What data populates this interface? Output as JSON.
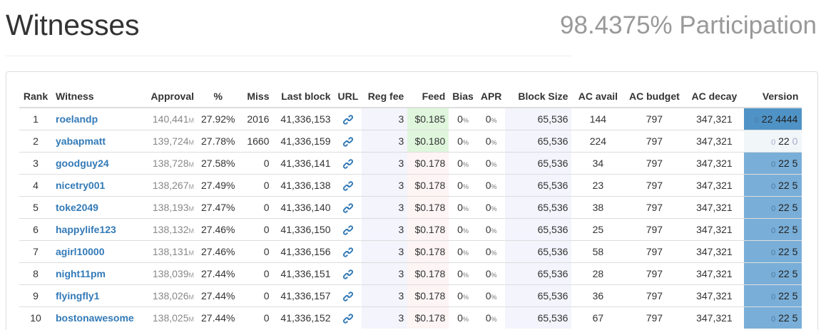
{
  "header": {
    "title": "Witnesses",
    "participation": "98.4375% Participation"
  },
  "table": {
    "columns": {
      "rank": "Rank",
      "witness": "Witness",
      "approval": "Approval",
      "percent": "%",
      "miss": "Miss",
      "last_block": "Last block",
      "url": "URL",
      "reg_fee": "Reg fee",
      "feed": "Feed",
      "bias": "Bias",
      "apr": "APR",
      "block_size": "Block Size",
      "ac_avail": "AC avail",
      "ac_budget": "AC budget",
      "ac_decay": "AC decay",
      "version": "Version"
    },
    "approval_unit": "M",
    "percent_unit": "%",
    "url_icon": "link-icon",
    "rows": [
      {
        "rank": "1",
        "name": "roelandp",
        "approval": "140,441",
        "percent": "27.92%",
        "miss": "2016",
        "last_block": "41,336,153",
        "reg_fee": "3",
        "feed": "$0.185",
        "bias": "0",
        "apr": "0",
        "block_size": "65,536",
        "ac_avail": "144",
        "ac_budget": "797",
        "ac_decay": "347,321",
        "ver_major": "0",
        "ver_minor": "22",
        "ver_patch": "4444"
      },
      {
        "rank": "2",
        "name": "yabapmatt",
        "approval": "139,724",
        "percent": "27.78%",
        "miss": "1660",
        "last_block": "41,336,159",
        "reg_fee": "3",
        "feed": "$0.180",
        "bias": "0",
        "apr": "0",
        "block_size": "65,536",
        "ac_avail": "224",
        "ac_budget": "797",
        "ac_decay": "347,321",
        "ver_major": "0",
        "ver_minor": "22",
        "ver_patch": "0"
      },
      {
        "rank": "3",
        "name": "goodguy24",
        "approval": "138,728",
        "percent": "27.58%",
        "miss": "0",
        "last_block": "41,336,141",
        "reg_fee": "3",
        "feed": "$0.178",
        "bias": "0",
        "apr": "0",
        "block_size": "65,536",
        "ac_avail": "34",
        "ac_budget": "797",
        "ac_decay": "347,321",
        "ver_major": "0",
        "ver_minor": "22",
        "ver_patch": "5"
      },
      {
        "rank": "4",
        "name": "nicetry001",
        "approval": "138,267",
        "percent": "27.49%",
        "miss": "0",
        "last_block": "41,336,138",
        "reg_fee": "3",
        "feed": "$0.178",
        "bias": "0",
        "apr": "0",
        "block_size": "65,536",
        "ac_avail": "23",
        "ac_budget": "797",
        "ac_decay": "347,321",
        "ver_major": "0",
        "ver_minor": "22",
        "ver_patch": "5"
      },
      {
        "rank": "5",
        "name": "toke2049",
        "approval": "138,193",
        "percent": "27.47%",
        "miss": "0",
        "last_block": "41,336,140",
        "reg_fee": "3",
        "feed": "$0.178",
        "bias": "0",
        "apr": "0",
        "block_size": "65,536",
        "ac_avail": "38",
        "ac_budget": "797",
        "ac_decay": "347,321",
        "ver_major": "0",
        "ver_minor": "22",
        "ver_patch": "5"
      },
      {
        "rank": "6",
        "name": "happylife123",
        "approval": "138,132",
        "percent": "27.46%",
        "miss": "0",
        "last_block": "41,336,150",
        "reg_fee": "3",
        "feed": "$0.178",
        "bias": "0",
        "apr": "0",
        "block_size": "65,536",
        "ac_avail": "25",
        "ac_budget": "797",
        "ac_decay": "347,321",
        "ver_major": "0",
        "ver_minor": "22",
        "ver_patch": "5"
      },
      {
        "rank": "7",
        "name": "agirl10000",
        "approval": "138,131",
        "percent": "27.46%",
        "miss": "0",
        "last_block": "41,336,156",
        "reg_fee": "3",
        "feed": "$0.178",
        "bias": "0",
        "apr": "0",
        "block_size": "65,536",
        "ac_avail": "58",
        "ac_budget": "797",
        "ac_decay": "347,321",
        "ver_major": "0",
        "ver_minor": "22",
        "ver_patch": "5"
      },
      {
        "rank": "8",
        "name": "night11pm",
        "approval": "138,039",
        "percent": "27.44%",
        "miss": "0",
        "last_block": "41,336,151",
        "reg_fee": "3",
        "feed": "$0.178",
        "bias": "0",
        "apr": "0",
        "block_size": "65,536",
        "ac_avail": "28",
        "ac_budget": "797",
        "ac_decay": "347,321",
        "ver_major": "0",
        "ver_minor": "22",
        "ver_patch": "5"
      },
      {
        "rank": "9",
        "name": "flyingfly1",
        "approval": "138,026",
        "percent": "27.44%",
        "miss": "0",
        "last_block": "41,336,157",
        "reg_fee": "3",
        "feed": "$0.178",
        "bias": "0",
        "apr": "0",
        "block_size": "65,536",
        "ac_avail": "36",
        "ac_budget": "797",
        "ac_decay": "347,321",
        "ver_major": "0",
        "ver_minor": "22",
        "ver_patch": "5"
      },
      {
        "rank": "10",
        "name": "bostonawesome",
        "approval": "138,025",
        "percent": "27.44%",
        "miss": "0",
        "last_block": "41,336,152",
        "reg_fee": "3",
        "feed": "$0.178",
        "bias": "0",
        "apr": "0",
        "block_size": "65,536",
        "ac_avail": "67",
        "ac_budget": "797",
        "ac_decay": "347,321",
        "ver_major": "0",
        "ver_minor": "22",
        "ver_patch": "5"
      }
    ]
  }
}
